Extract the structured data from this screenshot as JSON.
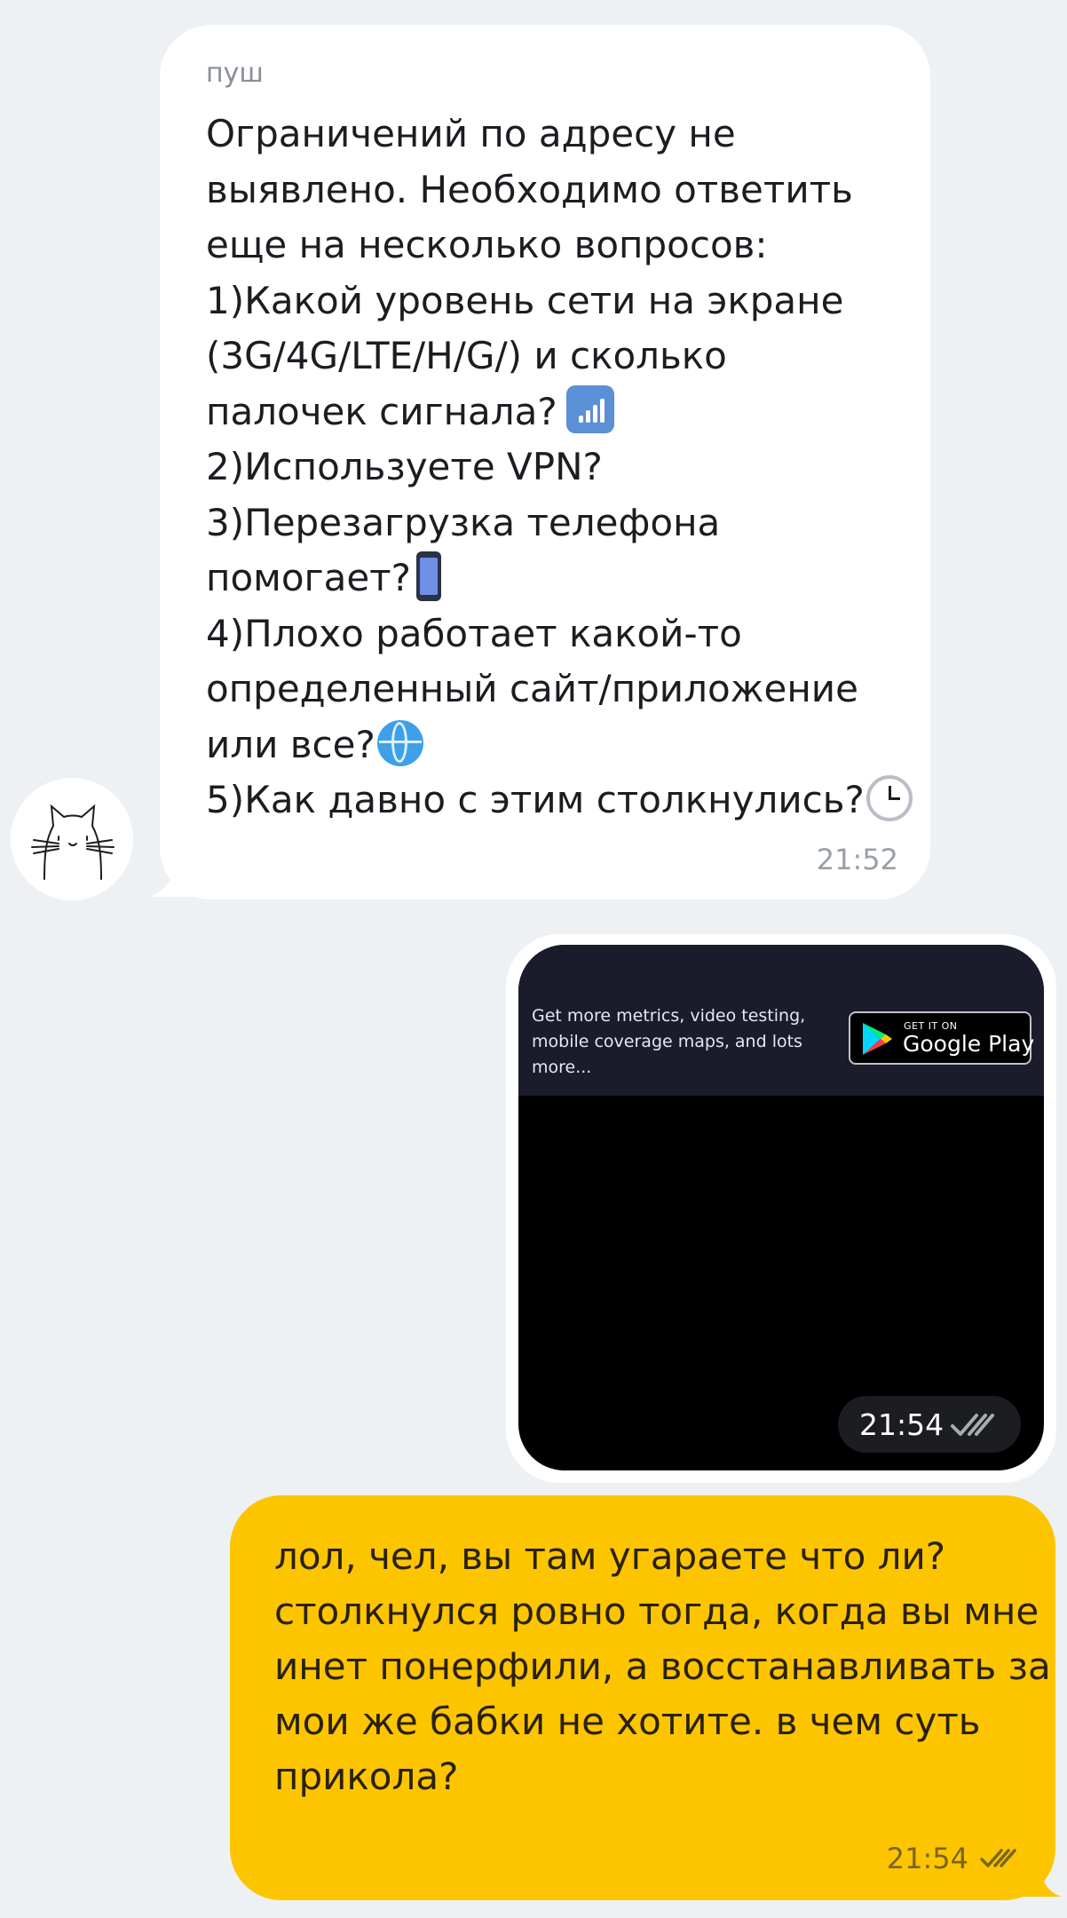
{
  "incoming": {
    "sender": "пуш",
    "lines": [
      "Ограничений по адресу не",
      "выявлено. Необходимо ответить",
      "еще на несколько вопросов:",
      "1)Какой уровень сети на экране",
      "(3G/4G/LTE/H/G/) и сколько",
      "палочек сигнала?",
      "2)Используете VPN?",
      "3)Перезагрузка телефона",
      "помогает?",
      "4)Плохо работает какой-то",
      "определенный сайт/приложение",
      "или все?",
      "5)Как давно с этим столкнулись?"
    ],
    "time": "21:52",
    "icons": [
      "signal-bars-emoji",
      "mobile-phone-emoji",
      "globe-emoji",
      "clock-emoji"
    ]
  },
  "image_message": {
    "banner_text": "Get more metrics, video testing, mobile coverage maps, and lots more...",
    "badge_small": "GET IT ON",
    "badge_big": "Google Play",
    "time": "21:54",
    "status": "read"
  },
  "outgoing": {
    "lines": [
      "лол, чел, вы там угараете что ли?",
      "столкнулся ровно тогда, когда вы мне",
      "инет понерфили, а восстанавливать за",
      "мои же бабки не хотите. в чем суть",
      "прикола?"
    ],
    "time": "21:54",
    "status": "read"
  },
  "colors": {
    "background": "#eef1f4",
    "incoming_bubble": "#ffffff",
    "outgoing_bubble": "#fdc500"
  }
}
